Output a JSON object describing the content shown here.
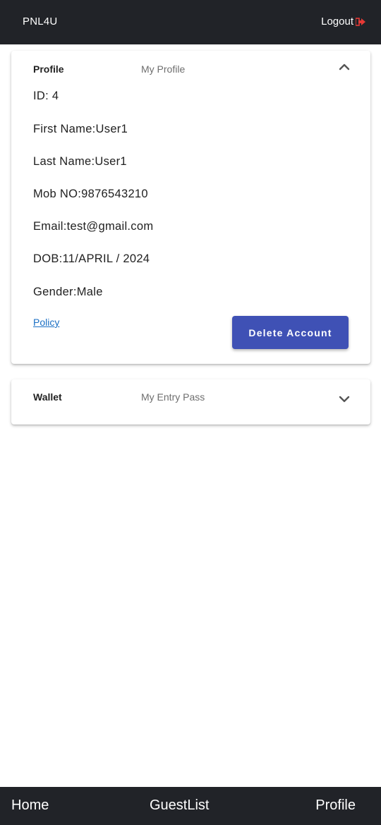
{
  "header": {
    "brand": "PNL4U",
    "logout_label": "Logout",
    "logout_icon": "logout-arrow-icon",
    "logout_icon_color": "#e53935"
  },
  "profile_card": {
    "title": "Profile",
    "subtitle": "My Profile",
    "expanded": true,
    "fields": {
      "id": "ID: 4",
      "first_name": "First Name:User1",
      "last_name": "Last Name:User1",
      "mobile": "Mob NO:9876543210",
      "email": "Email:test@gmail.com",
      "dob": "DOB:11/APRIL / 2024",
      "gender": "Gender:Male"
    },
    "policy_link": "Policy",
    "delete_button": "Delete Account",
    "delete_button_color": "#3f51b5"
  },
  "wallet_card": {
    "title": "Wallet",
    "subtitle": "My Entry Pass",
    "expanded": false
  },
  "bottom_nav": {
    "home": "Home",
    "guestlist": "GuestList",
    "profile": "Profile"
  }
}
